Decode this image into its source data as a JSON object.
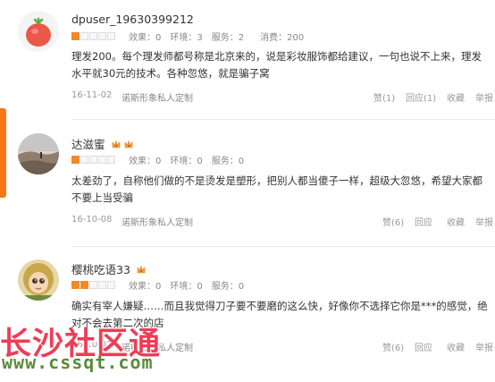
{
  "reviews": [
    {
      "username": "dpuser_19630399212",
      "rating": 1,
      "effect": "效果：0",
      "environment": "环境：3",
      "service": "服务：2",
      "spend": "消费：200",
      "content": "理发200。每个理发师都号称是北京来的，说是彩妆服饰都给建议，一句也说不上来，理发水平就30元的技术。各种忽悠，就是骗子窝",
      "date": "16-11-02",
      "shop": "诺斯形象私人定制",
      "like": "赞(1)",
      "reply": "回应(1)",
      "favorite": "收藏",
      "report": "举报",
      "avatar": "tomato-avatar-icon"
    },
    {
      "username": "达滋蜜",
      "rating": 1,
      "effect": "效果：0",
      "environment": "环境：0",
      "service": "服务：0",
      "spend": "",
      "content": "太差劲了，自称他们做的不是烫发是塑形，把别人都当傻子一样，超级大忽悠，希望大家都不要上当受骗",
      "date": "16-10-08",
      "shop": "诺斯形象私人定制",
      "like": "赞(6)",
      "reply": "回应",
      "favorite": "收藏",
      "report": "举报",
      "avatar": "landscape-avatar-icon"
    },
    {
      "username": "樱桃吃语33",
      "rating": 2,
      "effect": "效果：0",
      "environment": "环境：0",
      "service": "服务：0",
      "spend": "",
      "content": "确实有宰人嫌疑……而且我觉得刀子要不要磨的这么快，好像你不选择它你是***的感觉，绝对不会去第二次的店",
      "date": "16-10-03",
      "shop": "诺斯形象私人定制",
      "like": "赞(6)",
      "reply": "回应",
      "favorite": "收藏",
      "report": "举报",
      "avatar": "doll-avatar-icon"
    }
  ],
  "watermark": {
    "title": "长沙社区通",
    "url": "www.cssqt.com"
  },
  "colors": {
    "star_on": "#f08a2b",
    "side_tab": "#f8761a",
    "watermark_red": "#ee3d57",
    "watermark_green": "#5a8a3a"
  }
}
